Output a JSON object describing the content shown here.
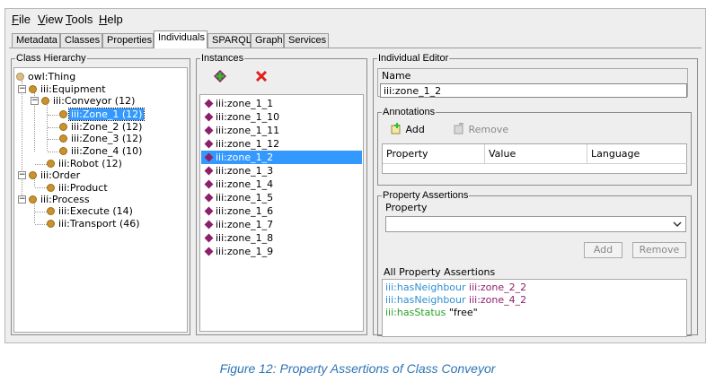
{
  "menu": [
    {
      "label": "File",
      "ul": "F",
      "rest": "ile"
    },
    {
      "label": "View",
      "ul": "V",
      "rest": "iew"
    },
    {
      "label": "Tools",
      "ul": "T",
      "rest": "ools"
    },
    {
      "label": "Help",
      "ul": "H",
      "rest": "elp"
    }
  ],
  "tabs": [
    "Metadata",
    "Classes",
    "Properties",
    "Individuals",
    "SPARQL",
    "Graph",
    "Services"
  ],
  "active_tab": "Individuals",
  "class_hierarchy": {
    "title": "Class Hierarchy",
    "nodes": [
      "owl:Thing",
      "iii:Equipment",
      "iii:Conveyor (12)",
      "iii:Zone_1 (12)",
      "iii:Zone_2 (12)",
      "iii:Zone_3 (12)",
      "iii:Zone_4 (10)",
      "iii:Robot (12)",
      "iii:Order",
      "iii:Product",
      "iii:Process",
      "iii:Execute (14)",
      "iii:Transport (46)"
    ],
    "selected": "iii:Zone_1 (12)"
  },
  "instances": {
    "title": "Instances",
    "add_icon": "add-individual-icon",
    "delete_icon": "delete-individual-icon",
    "items": [
      "iii:zone_1_1",
      "iii:zone_1_10",
      "iii:zone_1_11",
      "iii:zone_1_12",
      "iii:zone_1_2",
      "iii:zone_1_3",
      "iii:zone_1_4",
      "iii:zone_1_5",
      "iii:zone_1_6",
      "iii:zone_1_7",
      "iii:zone_1_8",
      "iii:zone_1_9"
    ],
    "selected": "iii:zone_1_2"
  },
  "editor": {
    "title": "Individual Editor",
    "name_label": "Name",
    "name_value": "iii:zone_1_2",
    "annotations": {
      "title": "Annotations",
      "add_label": "Add",
      "remove_label": "Remove",
      "columns": [
        "Property",
        "Value",
        "Language"
      ]
    },
    "property_assertions": {
      "title": "Property Assertions",
      "property_label": "Property",
      "property_value": "",
      "add_label": "Add",
      "remove_label": "Remove"
    },
    "all_assertions": {
      "title": "All Property Assertions",
      "rows": [
        {
          "property": "iii:hasNeighbour",
          "value": "iii:zone_2_2",
          "kind": "object"
        },
        {
          "property": "iii:hasNeighbour",
          "value": "iii:zone_4_2",
          "kind": "object"
        },
        {
          "property": "iii:hasStatus",
          "value": "\"free\"",
          "kind": "data"
        }
      ]
    }
  },
  "colors": {
    "object_property": "#2f8fd0",
    "individual": "#8e1f6b",
    "data_property": "#27a127",
    "selection": "#3399ff",
    "caption": "#2e74b5"
  },
  "caption": "Figure 12: Property Assertions of Class Conveyor"
}
